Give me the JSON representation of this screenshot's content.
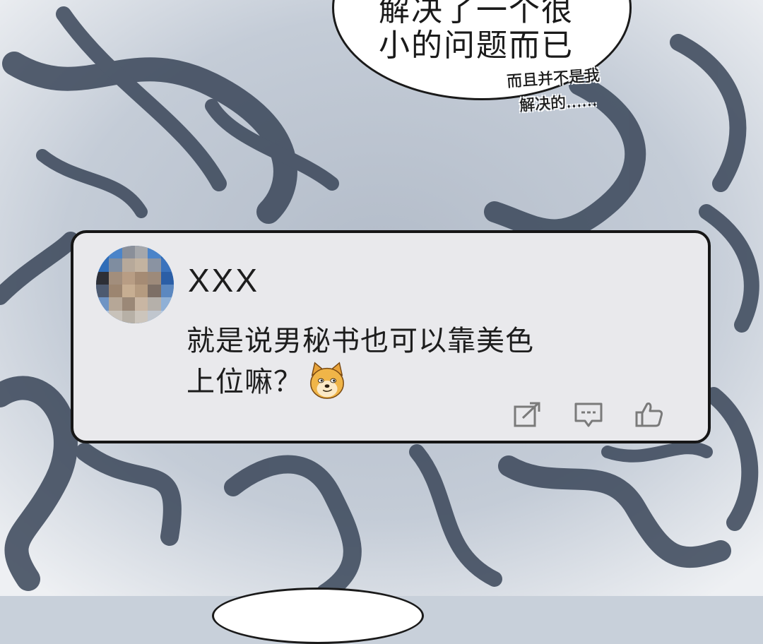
{
  "speech_bubble": {
    "line_1": "解决了一个很",
    "line_2": "小的问题而已"
  },
  "aside": {
    "line_1": "而且并不是我",
    "line_2": "解决的……"
  },
  "comment": {
    "username": "XXX",
    "text_line_1": "就是说男秘书也可以靠美色",
    "text_line_2": "上位嘛？",
    "emoji": "doge-emoji",
    "actions": [
      "share-icon",
      "reply-icon",
      "like-icon"
    ]
  },
  "colors": {
    "card_background": "#e9e9ec",
    "card_border": "#161616",
    "avatar_blue": "#3f7bc4",
    "background": "#c8d0da"
  }
}
